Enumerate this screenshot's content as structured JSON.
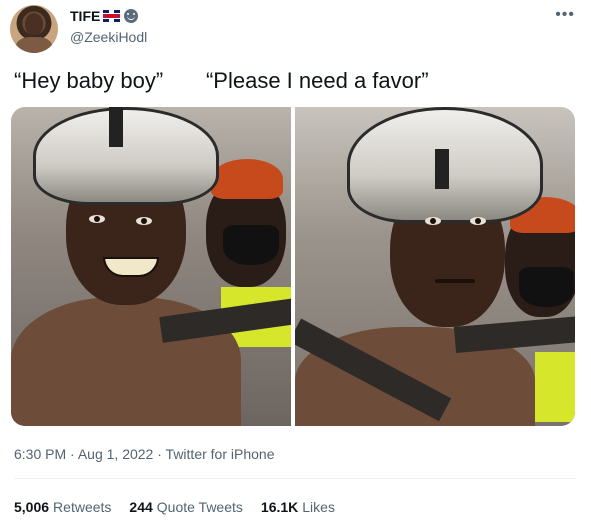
{
  "author": {
    "display_name": "TIFE",
    "handle": "@ZeekiHodl"
  },
  "tweet": {
    "text": "“Hey baby boy”       “Please I need a favor”",
    "time": "6:30 PM",
    "date": "Aug 1, 2022",
    "source": "Twitter for iPhone",
    "separator": "·",
    "more_label": "•••"
  },
  "stats": {
    "retweets_count": "5,006",
    "retweets_label": "Retweets",
    "quotes_count": "244",
    "quotes_label": "Quote Tweets",
    "likes_count": "16.1K",
    "likes_label": "Likes"
  },
  "icons": [
    "uk-flag-icon",
    "smiley-icon",
    "more-icon"
  ]
}
